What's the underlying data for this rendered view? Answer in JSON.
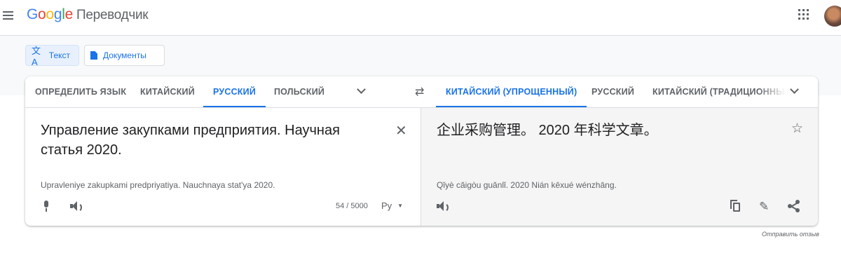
{
  "header": {
    "logo": [
      "G",
      "o",
      "o",
      "g",
      "l",
      "e"
    ],
    "product": "Переводчик"
  },
  "modes": {
    "text_label": "Текст",
    "docs_label": "Документы"
  },
  "source_langs": {
    "detect": "ОПРЕДЕЛИТЬ ЯЗЫК",
    "chinese": "КИТАЙСКИЙ",
    "russian": "РУССКИЙ",
    "polish": "ПОЛЬСКИЙ",
    "selected": "РУССКИЙ"
  },
  "target_langs": {
    "chinese_simplified": "КИТАЙСКИЙ (УПРОЩЕННЫЙ)",
    "russian": "РУССКИЙ",
    "chinese_traditional": "КИТАЙСКИЙ (ТРАДИЦИОННЫ",
    "selected": "КИТАЙСКИЙ (УПРОЩЕННЫЙ)"
  },
  "source": {
    "text": "Управление закупками предприятия. Научная статья 2020.",
    "transliteration": "Upravleniye zakupkami predpriyatiya. Nauchnaya stat'ya 2020.",
    "counter": "54 / 5000",
    "keyboard_label": "Ру"
  },
  "target": {
    "text": "企业采购管理。 2020 年科学文章。",
    "transliteration": "Qǐyè cǎigòu guǎnlǐ. 2020 Nián kēxué wénzhāng."
  },
  "footer": {
    "feedback": "Отправить отзыв"
  },
  "icons": {
    "menu": "hamburger-icon",
    "apps": "apps-grid-icon",
    "translate": "translate-icon",
    "document": "document-icon",
    "swap": "swap-icon",
    "close": "close-icon",
    "mic": "mic-icon",
    "speaker": "speaker-icon",
    "star": "star-icon",
    "copy": "copy-icon",
    "edit": "pencil-icon",
    "share": "share-icon"
  },
  "colors": {
    "accent": "#1a73e8",
    "text": "#202124",
    "muted": "#5f6368",
    "target_bg": "#f5f5f5"
  }
}
